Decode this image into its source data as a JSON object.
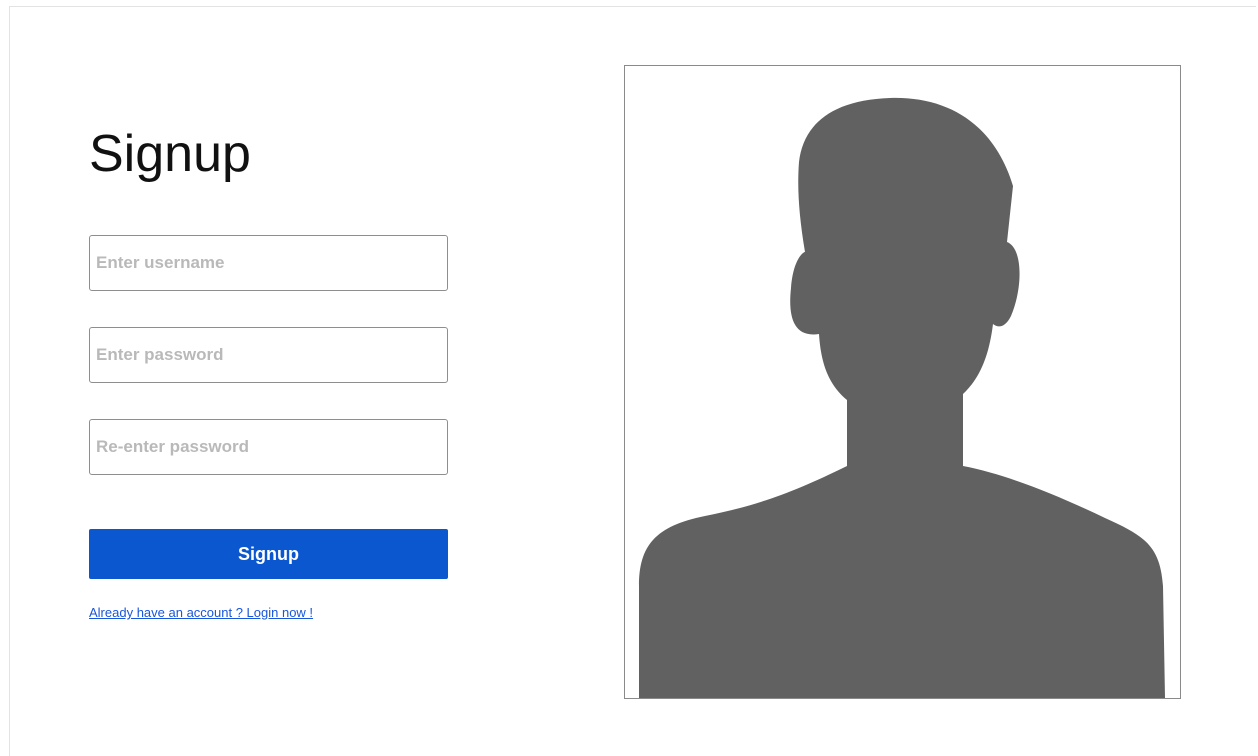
{
  "form": {
    "title": "Signup",
    "username_placeholder": "Enter username",
    "password_placeholder": "Enter password",
    "reenter_placeholder": "Re-enter password",
    "submit_label": "Signup",
    "login_link": "Already have an account ? Login now !"
  },
  "photo": {
    "icon": "person-silhouette-icon",
    "fill_color": "#616161"
  },
  "colors": {
    "button": "#0b57d0",
    "link": "#1a56db"
  }
}
